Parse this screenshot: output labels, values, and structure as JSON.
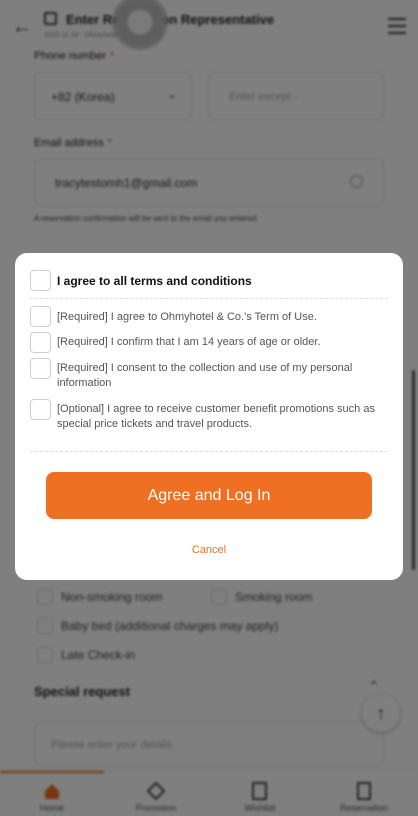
{
  "header": {
    "title": "Enter Reservation Representative",
    "subtitle": "2025.11.18 · Ohmyhotel & Co. Details",
    "back_icon": "arrow-left-icon",
    "menu_icon": "hamburger-menu-icon"
  },
  "form": {
    "phone_label": "Phone number",
    "phone_country": "+82 (Korea)",
    "phone_placeholder": "Enter except -",
    "email_label": "Email address",
    "email_value": "tracytestomh1@gmail.com",
    "email_hint": "A reservation confirmation will be sent to the email you entered.",
    "required_mark": "*",
    "options": [
      {
        "label": "Non-smoking room"
      },
      {
        "label": "Smoking room"
      },
      {
        "label": "Baby bed (additional charges may apply)"
      },
      {
        "label": "Late Check-in"
      }
    ],
    "special_request_title": "Special request",
    "special_request_placeholder": "Please enter your details."
  },
  "bottom_nav": [
    {
      "label": "Home",
      "icon": "home-icon",
      "active": true
    },
    {
      "label": "Promotion",
      "icon": "promotion-icon",
      "active": false
    },
    {
      "label": "Wishlist",
      "icon": "wishlist-icon",
      "active": false
    },
    {
      "label": "Reservation",
      "icon": "reservation-icon",
      "active": false
    }
  ],
  "modal": {
    "agree_all": "I agree to all terms and conditions",
    "terms": [
      {
        "text": "[Required] I agree to Ohmyhotel & Co.'s Term of Use."
      },
      {
        "text": "[Required] I confirm that I am 14 years of age or older."
      },
      {
        "text": "[Required] I consent to the collection and use of my personal information"
      },
      {
        "text": "[Optional] I agree to receive customer benefit promotions such as special price tickets and travel products."
      }
    ],
    "primary_button": "Agree and Log In",
    "cancel": "Cancel"
  },
  "colors": {
    "accent": "#ef7022",
    "overlay": "rgba(0,0,0,0.5)"
  }
}
